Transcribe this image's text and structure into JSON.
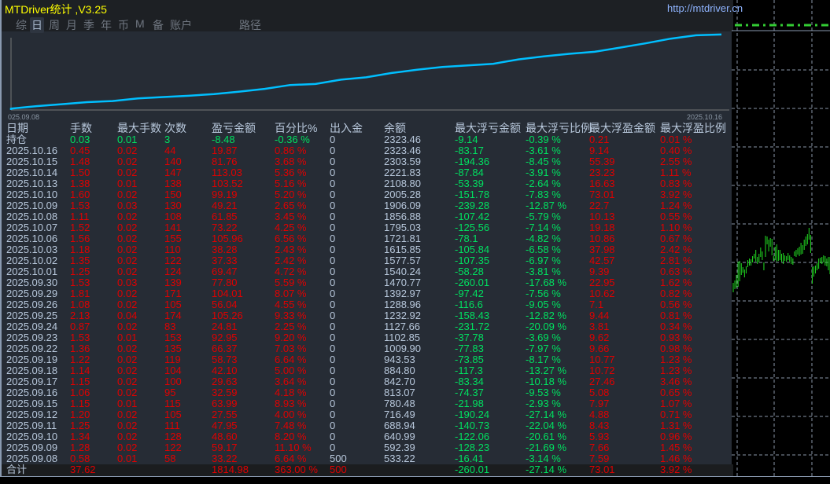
{
  "app": {
    "title": "MTDriver统计 ,V3.25",
    "url": "http://mtdriver.cn"
  },
  "tabs": [
    {
      "label": "综"
    },
    {
      "label": "日",
      "active": true
    },
    {
      "label": "周"
    },
    {
      "label": "月"
    },
    {
      "label": "季"
    },
    {
      "label": "年"
    },
    {
      "label": "币"
    },
    {
      "label": "M"
    },
    {
      "label": "备"
    },
    {
      "label": "账户"
    },
    {
      "label": "路径"
    }
  ],
  "equity_chart": {
    "start_label": "025.09.08",
    "end_label": "2025.10.16",
    "line_color": "#00bfff"
  },
  "columns": [
    "日期",
    "手数",
    "最大手数",
    "次数",
    "盈亏金额",
    "百分比%",
    "出入金",
    "余额",
    "最大浮亏金额",
    "最大浮亏比例",
    "最大浮盈金额",
    "最大浮盈比例"
  ],
  "position": [
    "持仓",
    "0.03",
    "0.01",
    "3",
    "-8.48",
    "-0.36 %",
    "0",
    "2323.46",
    "-9.14",
    "-0.39 %",
    "0.21",
    "0.01 %"
  ],
  "rows": [
    [
      "2025.10.16",
      "0.45",
      "0.02",
      "44",
      "19.87",
      "0.86 %",
      "0",
      "2323.46",
      "-83.17",
      "-3.61 %",
      "9.14",
      "0.40 %"
    ],
    [
      "2025.10.15",
      "1.48",
      "0.02",
      "140",
      "81.76",
      "3.68 %",
      "0",
      "2303.59",
      "-194.36",
      "-8.45 %",
      "55.39",
      "2.55 %"
    ],
    [
      "2025.10.14",
      "1.50",
      "0.02",
      "147",
      "113.03",
      "5.36 %",
      "0",
      "2221.83",
      "-87.84",
      "-3.91 %",
      "23.23",
      "1.11 %"
    ],
    [
      "2025.10.13",
      "1.38",
      "0.01",
      "138",
      "103.52",
      "5.16 %",
      "0",
      "2108.80",
      "-53.39",
      "-2.64 %",
      "16.63",
      "0.83 %"
    ],
    [
      "2025.10.10",
      "1.60",
      "0.02",
      "150",
      "99.19",
      "5.20 %",
      "0",
      "2005.28",
      "-151.78",
      "-7.83 %",
      "73.01",
      "3.92 %"
    ],
    [
      "2025.10.09",
      "1.53",
      "0.03",
      "130",
      "49.21",
      "2.65 %",
      "0",
      "1906.09",
      "-239.28",
      "-12.87 %",
      "22.7",
      "1.24 %"
    ],
    [
      "2025.10.08",
      "1.11",
      "0.02",
      "108",
      "61.85",
      "3.45 %",
      "0",
      "1856.88",
      "-107.42",
      "-5.79 %",
      "10.13",
      "0.55 %"
    ],
    [
      "2025.10.07",
      "1.52",
      "0.02",
      "141",
      "73.22",
      "4.25 %",
      "0",
      "1795.03",
      "-125.56",
      "-7.14 %",
      "19.18",
      "1.10 %"
    ],
    [
      "2025.10.06",
      "1.56",
      "0.02",
      "155",
      "105.96",
      "6.56 %",
      "0",
      "1721.81",
      "-78.1",
      "-4.82 %",
      "10.86",
      "0.67 %"
    ],
    [
      "2025.10.03",
      "1.18",
      "0.02",
      "110",
      "38.28",
      "2.43 %",
      "0",
      "1615.85",
      "-105.84",
      "-6.58 %",
      "37.98",
      "2.42 %"
    ],
    [
      "2025.10.02",
      "1.35",
      "0.02",
      "122",
      "37.33",
      "2.42 %",
      "0",
      "1577.57",
      "-107.35",
      "-6.97 %",
      "42.57",
      "2.81 %"
    ],
    [
      "2025.10.01",
      "1.25",
      "0.02",
      "124",
      "69.47",
      "4.72 %",
      "0",
      "1540.24",
      "-58.28",
      "-3.81 %",
      "9.39",
      "0.63 %"
    ],
    [
      "2025.09.30",
      "1.53",
      "0.03",
      "139",
      "77.80",
      "5.59 %",
      "0",
      "1470.77",
      "-260.01",
      "-17.68 %",
      "22.95",
      "1.62 %"
    ],
    [
      "2025.09.29",
      "1.81",
      "0.02",
      "171",
      "104.01",
      "8.07 %",
      "0",
      "1392.97",
      "-97.42",
      "-7.56 %",
      "10.62",
      "0.82 %"
    ],
    [
      "2025.09.26",
      "1.08",
      "0.02",
      "105",
      "56.04",
      "4.55 %",
      "0",
      "1288.96",
      "-116.6",
      "-9.05 %",
      "7.1",
      "0.56 %"
    ],
    [
      "2025.09.25",
      "2.13",
      "0.04",
      "174",
      "105.26",
      "9.33 %",
      "0",
      "1232.92",
      "-158.43",
      "-12.82 %",
      "9.44",
      "0.81 %"
    ],
    [
      "2025.09.24",
      "0.87",
      "0.02",
      "83",
      "24.81",
      "2.25 %",
      "0",
      "1127.66",
      "-231.72",
      "-20.09 %",
      "3.81",
      "0.34 %"
    ],
    [
      "2025.09.23",
      "1.53",
      "0.01",
      "153",
      "92.95",
      "9.20 %",
      "0",
      "1102.85",
      "-37.78",
      "-3.69 %",
      "9.62",
      "0.93 %"
    ],
    [
      "2025.09.22",
      "1.36",
      "0.02",
      "135",
      "66.37",
      "7.03 %",
      "0",
      "1009.90",
      "-77.83",
      "-7.97 %",
      "9.66",
      "0.98 %"
    ],
    [
      "2025.09.19",
      "1.22",
      "0.02",
      "119",
      "58.73",
      "6.64 %",
      "0",
      "943.53",
      "-73.85",
      "-8.17 %",
      "10.77",
      "1.23 %"
    ],
    [
      "2025.09.18",
      "1.14",
      "0.02",
      "104",
      "42.10",
      "5.00 %",
      "0",
      "884.80",
      "-117.3",
      "-13.27 %",
      "10.72",
      "1.23 %"
    ],
    [
      "2025.09.17",
      "1.15",
      "0.02",
      "100",
      "29.63",
      "3.64 %",
      "0",
      "842.70",
      "-83.34",
      "-10.18 %",
      "27.46",
      "3.46 %"
    ],
    [
      "2025.09.16",
      "1.06",
      "0.02",
      "95",
      "32.59",
      "4.18 %",
      "0",
      "813.07",
      "-74.37",
      "-9.53 %",
      "5.08",
      "0.65 %"
    ],
    [
      "2025.09.15",
      "1.15",
      "0.01",
      "115",
      "63.99",
      "8.93 %",
      "0",
      "780.48",
      "-21.98",
      "-2.93 %",
      "7.97",
      "1.07 %"
    ],
    [
      "2025.09.12",
      "1.20",
      "0.02",
      "105",
      "27.55",
      "4.00 %",
      "0",
      "716.49",
      "-190.24",
      "-27.14 %",
      "4.88",
      "0.71 %"
    ],
    [
      "2025.09.11",
      "1.25",
      "0.02",
      "111",
      "47.95",
      "7.48 %",
      "0",
      "688.94",
      "-140.73",
      "-22.04 %",
      "8.43",
      "1.31 %"
    ],
    [
      "2025.09.10",
      "1.34",
      "0.02",
      "128",
      "48.60",
      "8.20 %",
      "0",
      "640.99",
      "-122.06",
      "-20.61 %",
      "5.93",
      "0.96 %"
    ],
    [
      "2025.09.09",
      "1.28",
      "0.02",
      "122",
      "59.17",
      "11.10 %",
      "0",
      "592.39",
      "-128.23",
      "-21.69 %",
      "7.66",
      "1.45 %"
    ],
    [
      "2025.09.08",
      "0.58",
      "0.01",
      "58",
      "33.22",
      "6.64 %",
      "500",
      "533.22",
      "-16.41",
      "-3.14 %",
      "7.59",
      "1.46 %"
    ]
  ],
  "total": [
    "合计",
    "37.62",
    "",
    "",
    "1814.98",
    "363.00 %",
    "500",
    "",
    "-260.01",
    "-27.14 %",
    "73.01",
    "3.92 %"
  ],
  "colors": {
    "text": "#b8c8dc",
    "profit": "#e00000",
    "loss": "#00e060"
  }
}
